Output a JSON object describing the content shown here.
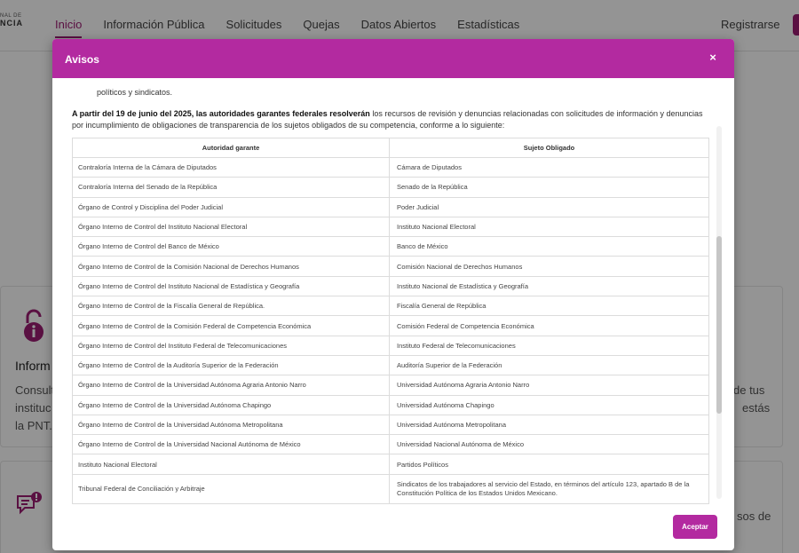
{
  "background": {
    "brand_line1": "NAL DE",
    "brand_line2": "NCIA",
    "nav": [
      "Inicio",
      "Información Pública",
      "Solicitudes",
      "Quejas",
      "Datos Abiertos",
      "Estadísticas"
    ],
    "register_label": "Registrarse",
    "card_title": "Inform",
    "card_lines": [
      "Consult",
      "instituc",
      "la PNT."
    ],
    "card_right_lines": [
      "de tus",
      "estás"
    ],
    "card2_right": "sos de"
  },
  "modal": {
    "title": "Avisos",
    "close_icon": "×",
    "fragment": "políticos y sindicatos.",
    "intro_bold": "A partir del 19 de junio del 2025, las autoridades garantes federales resolverán",
    "intro_rest": " los recursos de revisión y denuncias relacionadas con solicitudes de información y denuncias por incumplimiento de obligaciones de transparencia de los sujetos obligados de su competencia, conforme a lo siguiente:",
    "table": {
      "headers": [
        "Autoridad garante",
        "Sujeto Obligado"
      ],
      "rows": [
        [
          "Contraloría Interna de la Cámara de Diputados",
          "Cámara de Diputados"
        ],
        [
          "Contraloría Interna del Senado de la República",
          "Senado de la República"
        ],
        [
          "Órgano de Control y Disciplina del Poder Judicial",
          "Poder Judicial"
        ],
        [
          "Órgano Interno de Control del Instituto Nacional Electoral",
          "Instituto Nacional Electoral"
        ],
        [
          "Órgano Interno de Control del Banco de México",
          "Banco de México"
        ],
        [
          "Órgano Interno de Control de la Comisión Nacional de Derechos Humanos",
          "Comisión Nacional de Derechos Humanos"
        ],
        [
          "Órgano Interno de Control del Instituto Nacional de Estadística y Geografía",
          "Instituto Nacional de Estadística y Geografía"
        ],
        [
          "Órgano Interno de Control de la Fiscalía General de República.",
          "Fiscalía General de República"
        ],
        [
          "Órgano Interno de Control de la Comisión Federal de Competencia Económica",
          "Comisión Federal de Competencia Económica"
        ],
        [
          "Órgano Interno de Control del Instituto Federal de Telecomunicaciones",
          "Instituto Federal de Telecomunicaciones"
        ],
        [
          "Órgano Interno de Control de la Auditoría Superior de la Federación",
          "Auditoría Superior de la Federación"
        ],
        [
          "Órgano Interno de Control de la Universidad Autónoma Agraria Antonio Narro",
          "Universidad Autónoma Agraria Antonio Narro"
        ],
        [
          "Órgano Interno de Control de la Universidad Autónoma Chapingo",
          "Universidad Autónoma Chapingo"
        ],
        [
          "Órgano Interno de Control de la Universidad Autónoma Metropolitana",
          "Universidad Autónoma Metropolitana"
        ],
        [
          "Órgano Interno de Control de la Universidad Nacional Autónoma de México",
          "Universidad Nacional Autónoma de México"
        ],
        [
          "Instituto Nacional Electoral",
          "Partidos Políticos"
        ],
        [
          "Tribunal Federal de Conciliación y Arbitraje",
          "Sindicatos de los trabajadores al servicio del Estado, en términos del artículo 123, apartado B de la Constitución Política de los Estados Unidos Mexicano."
        ]
      ]
    },
    "accept_label": "Aceptar"
  },
  "colors": {
    "accent": "#b32aa0",
    "nav_active": "#9c1c72"
  }
}
